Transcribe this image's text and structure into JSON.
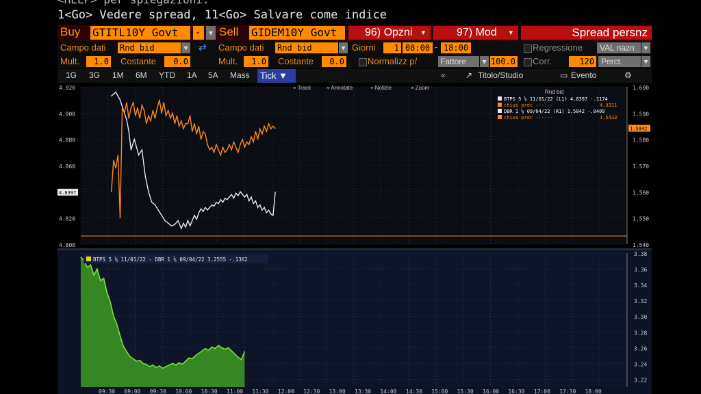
{
  "command": {
    "line1": "<HELP> per spiegazioni.",
    "line2": "1<Go> Vedere spread, 11<Go> Salvare come indice"
  },
  "toolbar": {
    "buy_label": "Buy",
    "buy_ticker": "GTITL10Y Govt",
    "dash": "-",
    "sell_label": "Sell",
    "sell_ticker": "GIDEM10Y Govt",
    "options": "96) Opzni",
    "modify": "97) Mod",
    "spread_title": "Spread persnz"
  },
  "row2": {
    "campo_dati_1": "Campo dati",
    "rnd_bid_1": "Rnd bid",
    "campo_dati_2": "Campo dati",
    "rnd_bid_2": "Rnd bid",
    "giorni": "Giorni",
    "giorni_val": "1",
    "time_from": "08:00",
    "time_dash": "-",
    "time_to": "18:00",
    "regressione": "Regressione",
    "val_nazn": "VAL nazn"
  },
  "row3": {
    "mult_1": "Mult.",
    "mult_1_val": "1.0",
    "costante_1": "Costante",
    "costante_1_val": "0.0",
    "mult_2": "Mult.",
    "mult_2_val": "1.0",
    "costante_2": "Costante",
    "costante_2_val": "0.0",
    "normalizz": "Normalizz p/",
    "fattore": "Fattore",
    "fattore_val": "100.0",
    "corr": "Corr.",
    "corr_val": "120",
    "percent": "Perct."
  },
  "periods": [
    "1G",
    "3G",
    "1M",
    "6M",
    "YTD",
    "1A",
    "5A",
    "Mass"
  ],
  "tick_tab": "Tick ▼",
  "right_tabs": {
    "titolo": "Titolo/Studio",
    "evento": "Evento"
  },
  "colors": {
    "orange": "#ff8c00",
    "red": "#b80f0f",
    "white_series": "#e8e8f0",
    "orange_series": "#ff8a1a",
    "green_area": "#7ee03a"
  },
  "chart_data": [
    {
      "type": "line",
      "tools": [
        "Track",
        "Annotate",
        "Notizie",
        "Zoom"
      ],
      "legend_title": "Rnd bid",
      "legend": [
        {
          "text": "BTPS 5 ⅛ 11/01/22 (L1) 4.8397 -.1174",
          "value": ""
        },
        {
          "text": "chius prec ------",
          "value": "4.9311"
        },
        {
          "text": "DBR 1 ⅛ 09/04/22 (R1) 1.5842 -.0409",
          "value": ""
        },
        {
          "text": "chius prec ------",
          "value": "1.5433"
        }
      ],
      "left_axis": {
        "ticks": [
          "4.920",
          "4.900",
          "4.880",
          "4.860",
          "4.840",
          "4.820",
          "4.800"
        ],
        "ylim": [
          4.8,
          4.92
        ],
        "marker": "4.8397"
      },
      "right_axis": {
        "ticks": [
          "1.600",
          "1.590",
          "1.580",
          "1.570",
          "1.560",
          "1.550",
          "1.540"
        ],
        "ylim": [
          1.54,
          1.6
        ],
        "marker": "1.5842"
      },
      "series": [
        {
          "name": "BTPS 5 ⅛ 11/01/22",
          "axis": "left",
          "color": "#e8e8f0",
          "x": [
            0.0,
            0.4,
            0.8,
            1.0,
            1.2,
            1.4,
            1.6,
            1.8,
            2.1,
            2.5,
            2.8,
            3.1,
            3.4,
            3.7,
            4.0,
            4.3,
            4.6,
            4.9,
            5.2,
            5.5,
            5.8,
            6.1,
            6.4,
            6.6,
            6.8,
            7.0,
            7.2,
            7.4,
            7.6,
            7.8,
            8.0,
            8.2,
            8.4,
            8.6,
            8.8,
            9.0,
            9.2,
            9.4,
            9.6,
            9.8,
            10.0,
            10.2,
            10.4,
            10.6,
            10.8,
            11.0,
            11.2,
            11.4,
            11.6,
            11.8,
            12.0,
            12.2,
            12.4,
            12.6,
            12.8,
            13.0,
            13.2,
            13.4,
            13.6,
            13.8,
            14.0,
            14.2,
            14.4,
            14.6,
            14.8,
            15.0
          ],
          "y": [
            4.913,
            4.916,
            4.91,
            4.905,
            4.9,
            4.895,
            4.886,
            4.872,
            4.88,
            4.868,
            4.872,
            4.852,
            4.84,
            4.832,
            4.83,
            4.826,
            4.822,
            4.818,
            4.816,
            4.814,
            4.815,
            4.818,
            4.812,
            4.816,
            4.813,
            4.818,
            4.814,
            4.818,
            4.822,
            4.819,
            4.824,
            4.827,
            4.825,
            4.828,
            4.826,
            4.828,
            4.83,
            4.829,
            4.832,
            4.831,
            4.834,
            4.832,
            4.835,
            4.834,
            4.836,
            4.838,
            4.835,
            4.839,
            4.837,
            4.84,
            4.838,
            4.836,
            4.838,
            4.833,
            4.836,
            4.831,
            4.833,
            4.828,
            4.83,
            4.826,
            4.828,
            4.824,
            4.826,
            4.823,
            4.822,
            4.8397
          ]
        },
        {
          "name": "DBR 1 ⅛ 09/04/22",
          "axis": "right",
          "color": "#ff8a1a",
          "x": [
            0.0,
            0.2,
            0.4,
            0.6,
            0.8,
            1.0,
            1.2,
            1.4,
            1.6,
            1.8,
            2.0,
            2.2,
            2.4,
            2.6,
            2.8,
            3.0,
            3.2,
            3.4,
            3.6,
            3.8,
            4.0,
            4.2,
            4.4,
            4.6,
            4.8,
            5.0,
            5.2,
            5.4,
            5.6,
            5.8,
            6.0,
            6.2,
            6.4,
            6.6,
            6.8,
            7.0,
            7.2,
            7.4,
            7.6,
            7.8,
            8.0,
            8.2,
            8.4,
            8.6,
            8.8,
            9.0,
            9.2,
            9.4,
            9.6,
            9.8,
            10.0,
            10.2,
            10.4,
            10.6,
            10.8,
            11.0,
            11.2,
            11.4,
            11.6,
            11.8,
            12.0,
            12.2,
            12.4,
            12.6,
            12.8,
            13.0,
            13.2,
            13.4,
            13.6,
            13.8,
            14.0,
            14.2,
            14.4,
            14.6,
            14.8,
            15.0
          ],
          "y": [
            1.56,
            1.572,
            1.569,
            1.574,
            1.55,
            1.592,
            1.59,
            1.594,
            1.588,
            1.592,
            1.594,
            1.589,
            1.592,
            1.588,
            1.593,
            1.591,
            1.586,
            1.589,
            1.587,
            1.591,
            1.588,
            1.592,
            1.595,
            1.59,
            1.594,
            1.589,
            1.591,
            1.588,
            1.59,
            1.586,
            1.589,
            1.585,
            1.587,
            1.584,
            1.586,
            1.586,
            1.589,
            1.583,
            1.586,
            1.582,
            1.585,
            1.58,
            1.583,
            1.582,
            1.578,
            1.576,
            1.577,
            1.575,
            1.578,
            1.576,
            1.574,
            1.577,
            1.575,
            1.576,
            1.578,
            1.576,
            1.579,
            1.577,
            1.575,
            1.578,
            1.58,
            1.577,
            1.579,
            1.578,
            1.581,
            1.579,
            1.583,
            1.58,
            1.584,
            1.582,
            1.585,
            1.583,
            1.586,
            1.584,
            1.585,
            1.5842
          ]
        }
      ],
      "x_window": [
        0,
        50
      ]
    },
    {
      "type": "area",
      "legend": "BTPS 5 ⅛ 11/01/22 - DBR 1 ⅛ 09/04/22 3.2555 -.1362",
      "right_axis": {
        "ticks": [
          "3.38",
          "3.36",
          "3.34",
          "3.32",
          "3.30",
          "3.28",
          "3.26",
          "3.24",
          "3.22"
        ],
        "ylim": [
          3.21,
          3.38
        ]
      },
      "x_labels": [
        "09:30",
        "09:00",
        "09:30",
        "10:00",
        "10:30",
        "11:00",
        "11:30",
        "12:00",
        "12:30",
        "13:00",
        "13:30",
        "14:00",
        "14:30",
        "15:00",
        "15:30",
        "16:00",
        "16:30",
        "17:00",
        "17:30",
        "18:00"
      ],
      "series": [
        {
          "name": "BTPS 5 ⅛ 11/01/22 - DBR 1 ⅛ 09/04/22",
          "color": "#7ee03a",
          "x": [
            0.0,
            0.3,
            0.6,
            0.9,
            1.2,
            1.5,
            1.8,
            2.1,
            2.4,
            2.7,
            3.0,
            3.3,
            3.6,
            3.9,
            4.2,
            4.5,
            4.8,
            5.1,
            5.4,
            5.7,
            6.0,
            6.3,
            6.6,
            6.9,
            7.2,
            7.5,
            7.8,
            8.1,
            8.4,
            8.7,
            9.0,
            9.3,
            9.6,
            9.9,
            10.2,
            10.5,
            10.8,
            11.1,
            11.4,
            11.7,
            12.0,
            12.3,
            12.6,
            12.9,
            13.2,
            13.5,
            13.8,
            14.1,
            14.4,
            14.7,
            15.0
          ],
          "y": [
            3.375,
            3.37,
            3.362,
            3.365,
            3.352,
            3.36,
            3.345,
            3.348,
            3.33,
            3.318,
            3.3,
            3.29,
            3.275,
            3.262,
            3.255,
            3.249,
            3.246,
            3.243,
            3.244,
            3.24,
            3.239,
            3.236,
            3.238,
            3.235,
            3.237,
            3.234,
            3.236,
            3.238,
            3.24,
            3.238,
            3.241,
            3.239,
            3.243,
            3.247,
            3.246,
            3.25,
            3.253,
            3.256,
            3.259,
            3.257,
            3.261,
            3.259,
            3.263,
            3.26,
            3.258,
            3.26,
            3.256,
            3.252,
            3.248,
            3.245,
            3.2555
          ]
        }
      ],
      "x_window": [
        0,
        50
      ]
    }
  ]
}
